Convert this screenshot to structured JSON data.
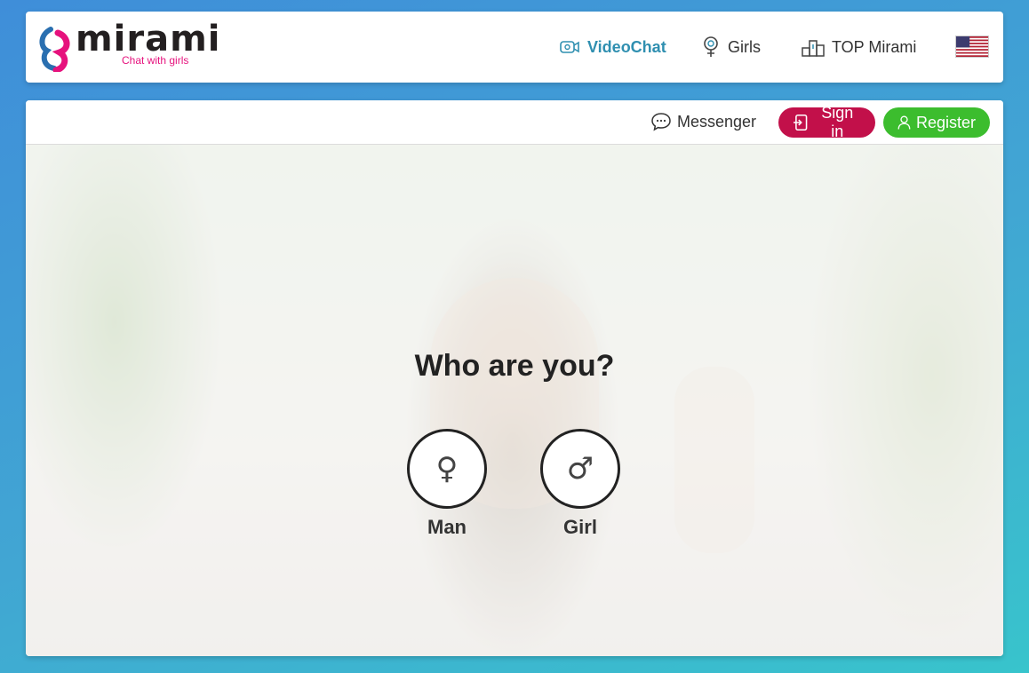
{
  "brand": {
    "name": "mirami",
    "tagline": "Chat with girls"
  },
  "nav": {
    "videochat": "VideoChat",
    "girls": "Girls",
    "top": "TOP Mirami"
  },
  "topbar": {
    "messenger": "Messenger",
    "signin": "Sign in",
    "register": "Register"
  },
  "hero": {
    "question": "Who are you?",
    "options": [
      {
        "symbol": "♀",
        "label": "Man"
      },
      {
        "symbol": "♂",
        "label": "Girl"
      }
    ]
  },
  "colors": {
    "accent_teal": "#2f8fb0",
    "signin": "#c2104a",
    "register": "#3cbd2e",
    "brand_pink": "#e6127d"
  }
}
